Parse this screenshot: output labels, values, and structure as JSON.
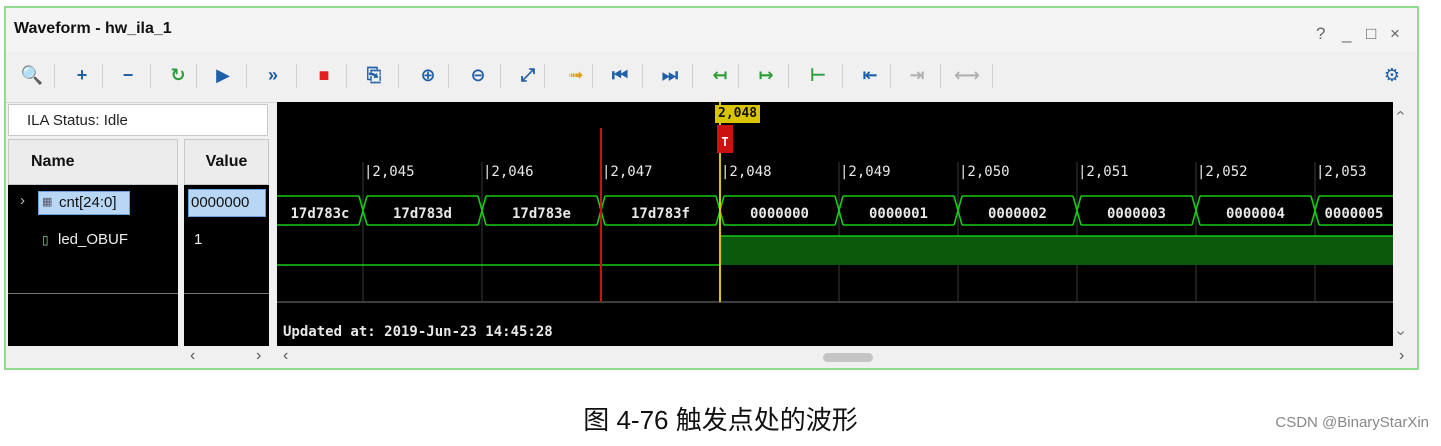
{
  "window": {
    "title": "Waveform - hw_ila_1",
    "controls": [
      "?",
      "_",
      "□",
      "×"
    ]
  },
  "toolbar": {
    "buttons": [
      {
        "name": "search-icon",
        "glyph": "🔍",
        "color": "#1f5fa8"
      },
      {
        "name": "add-icon",
        "glyph": "+",
        "color": "#1f5fa8"
      },
      {
        "name": "remove-icon",
        "glyph": "−",
        "color": "#1f5fa8"
      },
      {
        "name": "run-trigger-immediate-icon",
        "glyph": "↻",
        "color": "#2e9c3a"
      },
      {
        "name": "run-trigger-icon",
        "glyph": "▶",
        "color": "#1f5fa8"
      },
      {
        "name": "run-trigger-immediate-fast-icon",
        "glyph": "»",
        "color": "#1f5fa8"
      },
      {
        "name": "stop-icon",
        "glyph": "■",
        "color": "#e02020"
      },
      {
        "name": "export-icon",
        "glyph": "⎘",
        "color": "#1f5fa8"
      },
      {
        "name": "zoom-in-icon",
        "glyph": "⊕",
        "color": "#1f5fa8"
      },
      {
        "name": "zoom-out-icon",
        "glyph": "⊖",
        "color": "#1f5fa8"
      },
      {
        "name": "zoom-fit-icon",
        "glyph": "⤢",
        "color": "#1f5fa8"
      },
      {
        "name": "go-to-cursor-icon",
        "glyph": "➟",
        "color": "#e0a020"
      },
      {
        "name": "go-to-time-zero-icon",
        "glyph": "⏮",
        "color": "#1f5fa8"
      },
      {
        "name": "go-to-last-time-icon",
        "glyph": "⏭",
        "color": "#1f5fa8"
      },
      {
        "name": "previous-transition-icon",
        "glyph": "↤",
        "color": "#2e9c3a"
      },
      {
        "name": "next-transition-icon",
        "glyph": "↦",
        "color": "#2e9c3a"
      },
      {
        "name": "add-marker-icon",
        "glyph": "⊢",
        "color": "#2e9c3a"
      },
      {
        "name": "previous-marker-icon",
        "glyph": "⇤",
        "color": "#1f5fa8"
      },
      {
        "name": "next-marker-icon",
        "glyph": "⇥",
        "color": "#b0b0b0"
      },
      {
        "name": "swap-cursors-icon",
        "glyph": "⟷",
        "color": "#b0b0b0"
      }
    ],
    "settings_icon": "gear-icon"
  },
  "ila_status": "ILA Status:  Idle",
  "columns": {
    "name": "Name",
    "value": "Value"
  },
  "signals": [
    {
      "name": "cnt[24:0]",
      "value": "0000000",
      "kind": "bus",
      "icon": "bus-icon"
    },
    {
      "name": "led_OBUF",
      "value": "1",
      "kind": "bit",
      "icon": "bit-signal-icon"
    }
  ],
  "waveform": {
    "ticks": [
      "2,045",
      "2,046",
      "2,047",
      "2,048",
      "2,049",
      "2,050",
      "2,051",
      "2,052",
      "2,053"
    ],
    "bus_values": [
      "17d783c",
      "17d783d",
      "17d783e",
      "17d783f",
      "0000000",
      "0000001",
      "0000002",
      "0000003",
      "0000004",
      "0000005"
    ],
    "trigger_marker": "T",
    "cursor_label": "2,048",
    "updated_at": "Updated at: 2019-Jun-23 14:45:28",
    "colors": {
      "trace": "#19c819",
      "high_fill": "#0b5a0b",
      "trigger": "#cc1111",
      "cursor": "#d9c400",
      "background": "#000000"
    }
  },
  "caption": "图  4-76  触发点处的波形",
  "credit": "CSDN @BinaryStarXin"
}
